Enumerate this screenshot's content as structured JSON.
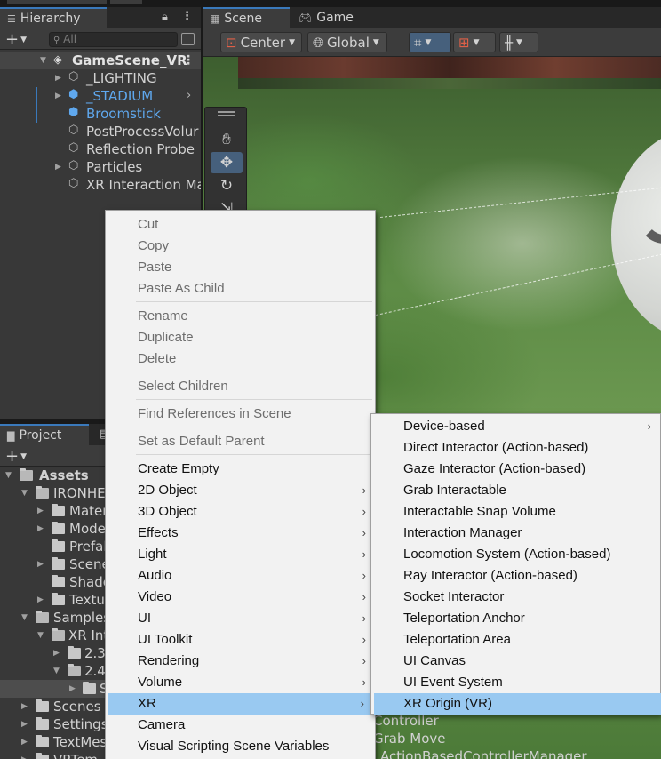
{
  "hierarchy": {
    "tab_label": "Hierarchy",
    "search_placeholder": "All",
    "items": [
      {
        "label": "GameScene_VR",
        "type": "scene"
      },
      {
        "label": "_LIGHTING"
      },
      {
        "label": "_STADIUM"
      },
      {
        "label": "Broomstick"
      },
      {
        "label": "PostProcessVolur"
      },
      {
        "label": "Reflection Probe"
      },
      {
        "label": "Particles"
      },
      {
        "label": "XR Interaction Ma"
      }
    ]
  },
  "scene": {
    "tabs": [
      {
        "label": "Scene"
      },
      {
        "label": "Game"
      }
    ],
    "pivot_label": "Center",
    "space_label": "Global"
  },
  "project": {
    "tab_label": "Project",
    "items": [
      {
        "label": "Assets"
      },
      {
        "label": "IRONHEA"
      },
      {
        "label": "Mater"
      },
      {
        "label": "Mode"
      },
      {
        "label": "Prefal"
      },
      {
        "label": "Scene"
      },
      {
        "label": "Shade"
      },
      {
        "label": "Textu"
      },
      {
        "label": "Samples"
      },
      {
        "label": "XR Int"
      },
      {
        "label": "2.3"
      },
      {
        "label": "2.4"
      },
      {
        "label": "S"
      },
      {
        "label": "Scenes"
      },
      {
        "label": "Settings"
      },
      {
        "label": "TextMes"
      },
      {
        "label": "VRTem"
      }
    ]
  },
  "context_menu": {
    "items": [
      {
        "label": "Cut",
        "disabled": true
      },
      {
        "label": "Copy",
        "disabled": true
      },
      {
        "label": "Paste",
        "disabled": true
      },
      {
        "label": "Paste As Child",
        "disabled": true
      },
      {
        "label": "Rename",
        "disabled": true
      },
      {
        "label": "Duplicate",
        "disabled": true
      },
      {
        "label": "Delete",
        "disabled": true
      },
      {
        "label": "Select Children",
        "disabled": true
      },
      {
        "label": "Find References in Scene",
        "disabled": true
      },
      {
        "label": "Set as Default Parent",
        "disabled": true
      },
      {
        "label": "Create Empty"
      },
      {
        "label": "2D Object",
        "submenu": true
      },
      {
        "label": "3D Object",
        "submenu": true
      },
      {
        "label": "Effects",
        "submenu": true
      },
      {
        "label": "Light",
        "submenu": true
      },
      {
        "label": "Audio",
        "submenu": true
      },
      {
        "label": "Video",
        "submenu": true
      },
      {
        "label": "UI",
        "submenu": true
      },
      {
        "label": "UI Toolkit",
        "submenu": true
      },
      {
        "label": "Rendering",
        "submenu": true
      },
      {
        "label": "Volume",
        "submenu": true
      },
      {
        "label": "XR",
        "submenu": true,
        "highlighted": true
      },
      {
        "label": "Camera"
      },
      {
        "label": "Visual Scripting Scene Variables"
      }
    ]
  },
  "xr_submenu": {
    "items": [
      {
        "label": "Device-based",
        "submenu": true
      },
      {
        "label": "Direct Interactor (Action-based)"
      },
      {
        "label": "Gaze Interactor (Action-based)"
      },
      {
        "label": "Grab Interactable"
      },
      {
        "label": "Interactable Snap Volume"
      },
      {
        "label": "Interaction Manager"
      },
      {
        "label": "Locomotion System (Action-based)"
      },
      {
        "label": "Ray Interactor (Action-based)"
      },
      {
        "label": "Socket Interactor"
      },
      {
        "label": "Teleportation Anchor"
      },
      {
        "label": "Teleportation Area"
      },
      {
        "label": "UI Canvas"
      },
      {
        "label": "UI Event System"
      },
      {
        "label": "XR Origin (VR)",
        "highlighted": true
      }
    ]
  },
  "background_text": {
    "line1": "Controller",
    "line2": "Grab Move",
    "line3": "ActionBasedControllerManager"
  },
  "colors": {
    "selection_blue": "#99c9f1",
    "accent": "#3a79bb",
    "prefab_blue": "#5fa8ee"
  }
}
